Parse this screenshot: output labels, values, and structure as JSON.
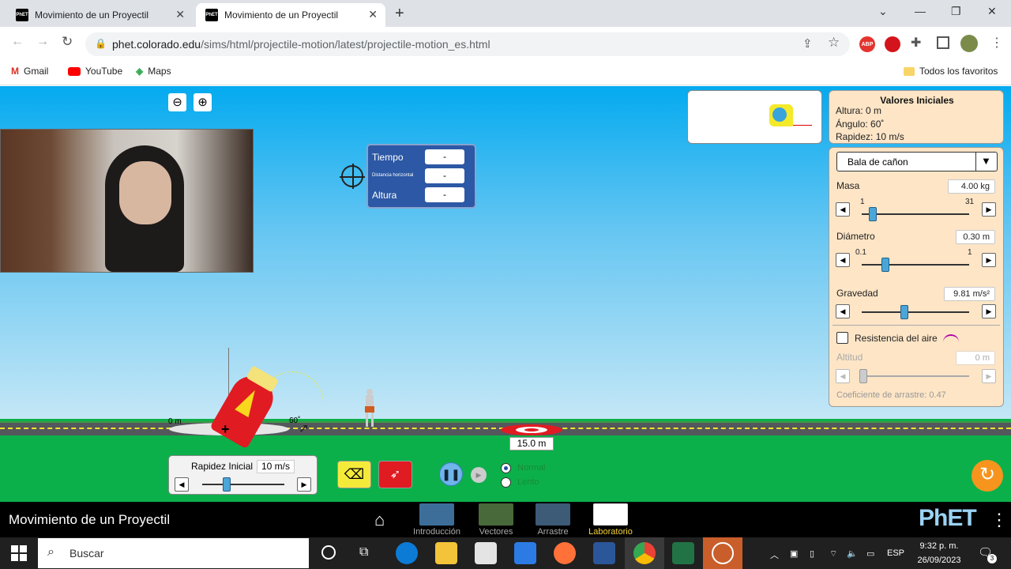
{
  "browser": {
    "tabs": [
      {
        "title": "Movimiento de un Proyectil",
        "favicon": "PhET"
      },
      {
        "title": "Movimiento de un Proyectil",
        "favicon": "PhET"
      }
    ],
    "url_host": "phet.colorado.edu",
    "url_path": "/sims/html/projectile-motion/latest/projectile-motion_es.html",
    "bookmarks": [
      "Gmail",
      "YouTube",
      "Maps"
    ],
    "all_bookmarks": "Todos los favoritos",
    "ext_badge": "ABP"
  },
  "sim": {
    "readout": {
      "time_label": "Tiempo",
      "dist_label": "Distancia horizontal",
      "height_label": "Altura",
      "time": "-",
      "dist": "-",
      "height": "-"
    },
    "initial": {
      "title": "Valores Iniciales",
      "height": "Altura: 0 m",
      "angle": "Ángulo: 60˚",
      "speed": "Rapidez: 10 m/s"
    },
    "projectile": "Bala de cañon",
    "mass": {
      "label": "Masa",
      "value": "4.00 kg",
      "min": "1",
      "max": "31",
      "pos": 0.1
    },
    "diameter": {
      "label": "Diámetro",
      "value": "0.30 m",
      "min": "0.1",
      "max": "1",
      "pos": 0.22
    },
    "gravity": {
      "label": "Gravedad",
      "value": "9.81 m/s²",
      "pos": 0.4
    },
    "air": {
      "label": "Resistencia del aire",
      "checked": false
    },
    "altitude": {
      "label": "Altitud",
      "value": "0 m"
    },
    "drag": "Coeficiente de arrastre: 0.47",
    "cannon": {
      "height_label": "0 m",
      "angle_label": "60˚"
    },
    "target_distance": "15.0 m",
    "speed_control": {
      "label": "Rapidez Inicial",
      "value": "10 m/s",
      "pos": 0.3
    },
    "speed_mode": {
      "normal": "Normal",
      "slow": "Lento",
      "selected": "Normal"
    },
    "title": "Movimiento de un Proyectil",
    "screens": [
      "Introducción",
      "Vectores",
      "Arrastre",
      "Laboratorio"
    ],
    "logo": "PhET"
  },
  "taskbar": {
    "search": "Buscar",
    "lang": "ESP",
    "time": "9:32 p. m.",
    "date": "26/09/2023",
    "notif": "3"
  },
  "colors": {
    "sky_top": "#04aaf0",
    "grass": "#0cb04a",
    "cannon": "#e11b22",
    "accent": "#f7941d"
  }
}
